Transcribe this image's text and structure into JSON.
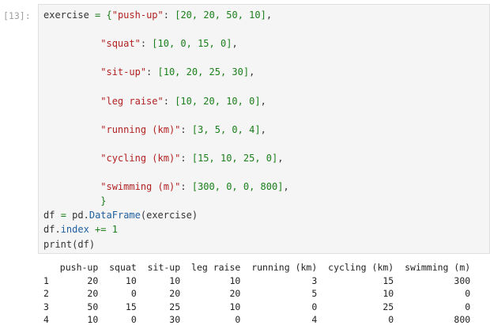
{
  "cell": {
    "prompt": "[13]:",
    "code": {
      "var": "exercise",
      "entries": [
        {
          "key": "\"push-up\"",
          "values": "[20, 20, 50, 10]"
        },
        {
          "key": "\"squat\"",
          "values": "[10, 0, 15, 0]"
        },
        {
          "key": "\"sit-up\"",
          "values": "[10, 20, 25, 30]"
        },
        {
          "key": "\"leg raise\"",
          "values": "[10, 20, 10, 0]"
        },
        {
          "key": "\"running (km)\"",
          "values": "[3, 5, 0, 4]"
        },
        {
          "key": "\"cycling (km)\"",
          "values": "[15, 10, 25, 0]"
        },
        {
          "key": "\"swimming (m)\"",
          "values": "[300, 0, 0, 800]"
        }
      ],
      "line_df_lhs": "df",
      "line_df_mod": "pd",
      "line_df_func": "DataFrame",
      "line_df_arg": "exercise",
      "line_index_obj": "df",
      "line_index_attr": "index",
      "line_index_op": "+=",
      "line_index_num": "1",
      "line_print_func": "print",
      "line_print_arg": "df"
    }
  },
  "output": {
    "columns": [
      "push-up",
      "squat",
      "sit-up",
      "leg raise",
      "running (km)",
      "cycling (km)",
      "swimming (m)"
    ],
    "rows": [
      {
        "index": "1",
        "values": [
          "20",
          "10",
          "10",
          "10",
          "3",
          "15",
          "300"
        ]
      },
      {
        "index": "2",
        "values": [
          "20",
          "0",
          "20",
          "20",
          "5",
          "10",
          "0"
        ]
      },
      {
        "index": "3",
        "values": [
          "50",
          "15",
          "25",
          "10",
          "0",
          "25",
          "0"
        ]
      },
      {
        "index": "4",
        "values": [
          "10",
          "0",
          "30",
          "0",
          "4",
          "0",
          "800"
        ]
      }
    ]
  }
}
